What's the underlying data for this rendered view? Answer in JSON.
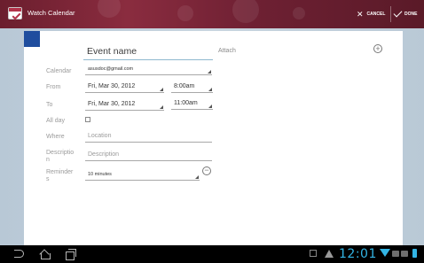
{
  "action_bar": {
    "app_title": "Watch Calendar",
    "app_icon": "calendar-check-icon",
    "cancel_label": "CANCEL",
    "done_label": "DONE"
  },
  "event": {
    "color": "#1f4d9e",
    "name_placeholder": "Event name",
    "attach_label": "Attach"
  },
  "form": {
    "calendar_label": "Calendar",
    "calendar_value": "asusdoc@gmail.com",
    "from_label": "From",
    "from_date": "Fri, Mar 30, 2012",
    "from_time": "8:00am",
    "to_label": "To",
    "to_date": "Fri, Mar 30, 2012",
    "to_time": "11:00am",
    "allday_label": "All day",
    "allday_checked": false,
    "where_label": "Where",
    "where_placeholder": "Location",
    "description_label_l1": "Descriptio",
    "description_label_l2": "n",
    "description_placeholder": "Description",
    "reminders_label_l1": "Reminder",
    "reminders_label_l2": "s",
    "reminder_value": "10 minutes"
  },
  "system_bar": {
    "clock": "12:01",
    "accent": "#33b5e5"
  }
}
